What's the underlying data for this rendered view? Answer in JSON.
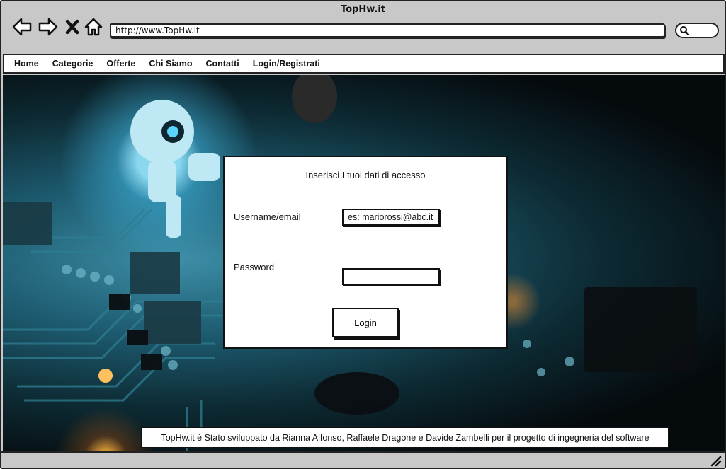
{
  "window": {
    "title": "TopHw.it"
  },
  "browser": {
    "url": "http://www.TopHw.it",
    "icons": [
      "back-arrow-icon",
      "forward-arrow-icon",
      "close-x-icon",
      "home-icon",
      "search-icon"
    ]
  },
  "menu": {
    "items": [
      "Home",
      "Categorie",
      "Offerte",
      "Chi Siamo",
      "Contatti",
      "Login/Registrati"
    ]
  },
  "login": {
    "title": "Inserisci I tuoi dati di accesso",
    "username_label": "Username/email",
    "username_placeholder": "es: mariorossi@abc.it",
    "password_label": "Password",
    "password_value": "",
    "button_label": "Login"
  },
  "footer": {
    "credit": "TopHw.it è Stato sviluppato da Rianna Alfonso, Raffaele Dragone e Davide Zambelli per il progetto di ingegneria del software"
  }
}
